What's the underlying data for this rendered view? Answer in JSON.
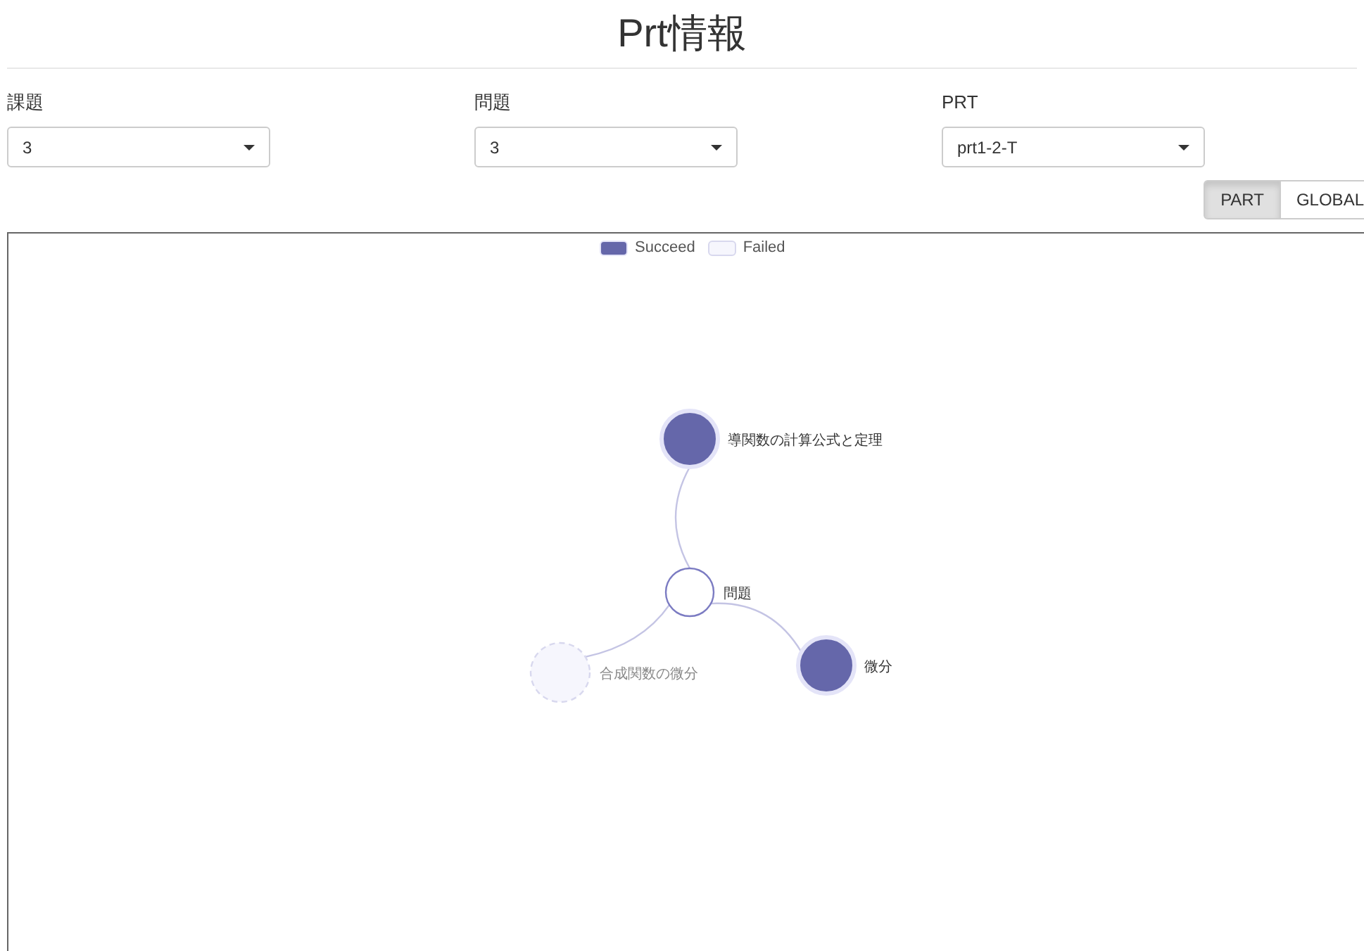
{
  "title": "Prt情報",
  "selects": [
    {
      "label": "課題",
      "value": "3"
    },
    {
      "label": "問題",
      "value": "3"
    },
    {
      "label": "PRT",
      "value": "prt1-2-T"
    }
  ],
  "view_toggle": [
    {
      "label": "PART",
      "selected": true
    },
    {
      "label": "GLOBAL",
      "selected": false
    }
  ],
  "legend": [
    {
      "label": "Succeed",
      "kind": "succeed"
    },
    {
      "label": "Failed",
      "kind": "failed"
    }
  ],
  "nodes": [
    {
      "label": "導関数の計算公式と定理",
      "kind": "succeed"
    },
    {
      "label": "問題",
      "kind": "center"
    },
    {
      "label": "合成関数の微分",
      "kind": "failed"
    },
    {
      "label": "微分",
      "kind": "succeed"
    }
  ]
}
